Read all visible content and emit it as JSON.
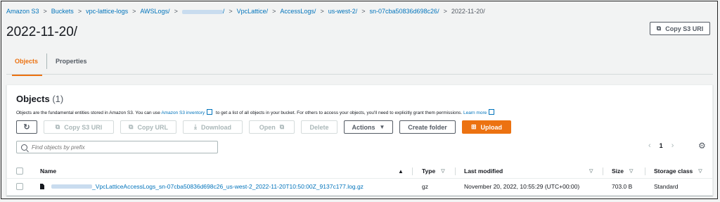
{
  "breadcrumb": [
    {
      "label": "Amazon S3",
      "current": false
    },
    {
      "label": "Buckets",
      "current": false
    },
    {
      "label": "vpc-lattice-logs",
      "current": false
    },
    {
      "label": "AWSLogs/",
      "current": false
    },
    {
      "label": "/",
      "current": false,
      "redacted": true
    },
    {
      "label": "VpcLattice/",
      "current": false
    },
    {
      "label": "AccessLogs/",
      "current": false
    },
    {
      "label": "us-west-2/",
      "current": false
    },
    {
      "label": "sn-07cba50836d698c26/",
      "current": false
    },
    {
      "label": "2022-11-20/",
      "current": true
    }
  ],
  "page_title": "2022-11-20/",
  "copy_uri_top": "Copy S3 URI",
  "tabs": [
    {
      "label": "Objects",
      "active": true
    },
    {
      "label": "Properties",
      "active": false
    }
  ],
  "panel": {
    "title": "Objects",
    "count": "(1)",
    "desc_part1": "Objects are the fundamental entities stored in Amazon S3. You can use ",
    "desc_link1": "Amazon S3 inventory",
    "desc_part2": " to get a list of all objects in your bucket. For others to access your objects, you'll need to explicitly grant them permissions. ",
    "desc_link2": "Learn more"
  },
  "toolbar": {
    "copy_uri": "Copy S3 URI",
    "copy_url": "Copy URL",
    "download": "Download",
    "open": "Open",
    "delete": "Delete",
    "actions": "Actions",
    "create_folder": "Create folder",
    "upload": "Upload"
  },
  "search": {
    "placeholder": "Find objects by prefix"
  },
  "pager": {
    "page": "1"
  },
  "columns": {
    "name": "Name",
    "type": "Type",
    "last_modified": "Last modified",
    "size": "Size",
    "storage_class": "Storage class"
  },
  "rows": [
    {
      "name": "_VpcLatticeAccessLogs_sn-07cba50836d698c26_us-west-2_2022-11-20T10:50:00Z_9137c177.log.gz",
      "type": "gz",
      "last_modified": "November 20, 2022, 10:55:29 (UTC+00:00)",
      "size": "703.0 B",
      "storage_class": "Standard"
    }
  ],
  "colors": {
    "accent": "#ec7211",
    "link": "#0073bb"
  }
}
